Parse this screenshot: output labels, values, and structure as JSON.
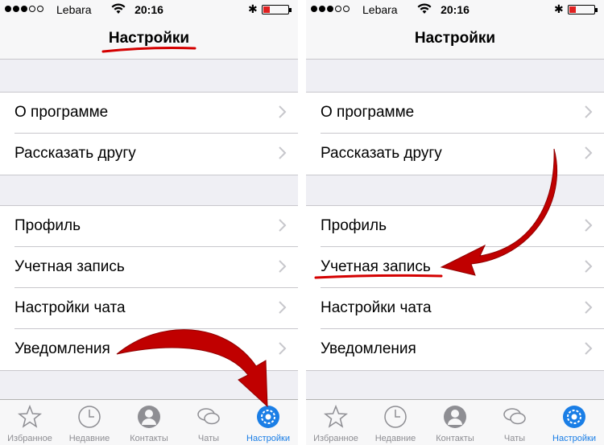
{
  "left": {
    "status": {
      "carrier": "Lebara",
      "time": "20:16"
    },
    "nav_title": "Настройки",
    "group1": [
      {
        "label": "О программе"
      },
      {
        "label": "Рассказать другу"
      }
    ],
    "group2": [
      {
        "label": "Профиль"
      },
      {
        "label": "Учетная запись"
      },
      {
        "label": "Настройки чата"
      },
      {
        "label": "Уведомления"
      }
    ],
    "tabs": [
      {
        "label": "Избранное"
      },
      {
        "label": "Недавние"
      },
      {
        "label": "Контакты"
      },
      {
        "label": "Чаты"
      },
      {
        "label": "Настройки"
      }
    ]
  },
  "right": {
    "status": {
      "carrier": "Lebara",
      "time": "20:16"
    },
    "nav_title": "Настройки",
    "group1": [
      {
        "label": "О программе"
      },
      {
        "label": "Рассказать другу"
      }
    ],
    "group2": [
      {
        "label": "Профиль"
      },
      {
        "label": "Учетная запись"
      },
      {
        "label": "Настройки чата"
      },
      {
        "label": "Уведомления"
      }
    ],
    "tabs": [
      {
        "label": "Избранное"
      },
      {
        "label": "Недавние"
      },
      {
        "label": "Контакты"
      },
      {
        "label": "Чаты"
      },
      {
        "label": "Настройки"
      }
    ]
  },
  "colors": {
    "accent": "#1a7ee6",
    "annotation": "#d40000",
    "battery": "#e02020"
  },
  "icons": [
    "star-icon",
    "clock-icon",
    "contact-icon",
    "chat-bubbles-icon",
    "gear-icon",
    "chevron-right-icon",
    "wifi-icon",
    "bluetooth-icon",
    "battery-icon"
  ]
}
